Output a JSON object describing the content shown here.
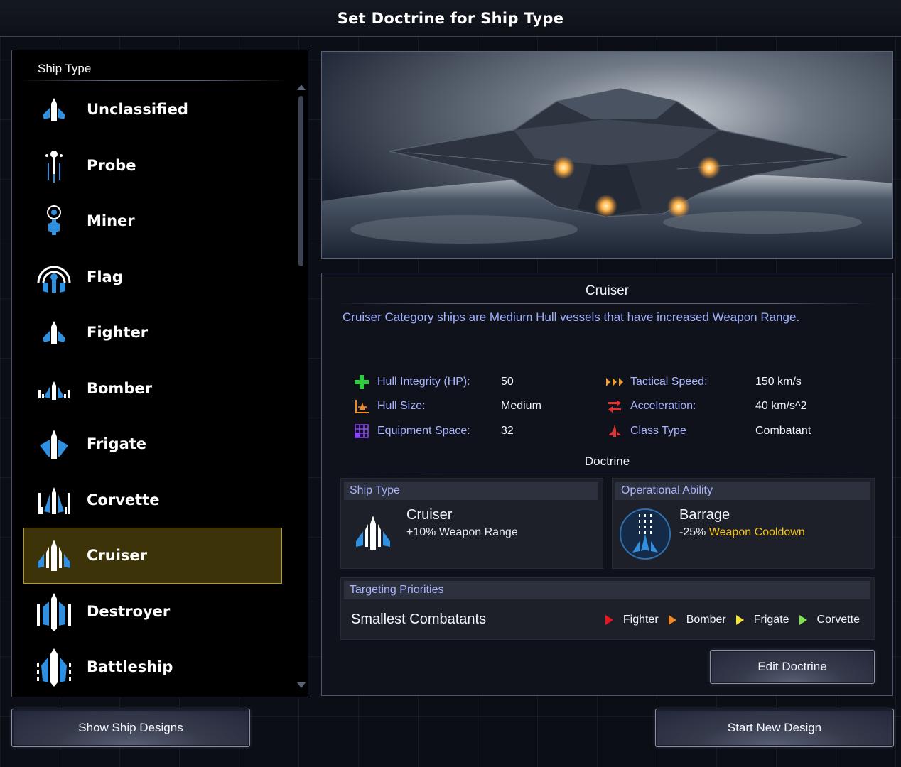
{
  "title": "Set Doctrine for Ship Type",
  "ship_list": {
    "header": "Ship Type",
    "items": [
      {
        "label": "Unclassified",
        "icon": "unclassified-ship-icon"
      },
      {
        "label": "Probe",
        "icon": "probe-ship-icon"
      },
      {
        "label": "Miner",
        "icon": "miner-ship-icon"
      },
      {
        "label": "Flag",
        "icon": "flag-ship-icon"
      },
      {
        "label": "Fighter",
        "icon": "fighter-ship-icon"
      },
      {
        "label": "Bomber",
        "icon": "bomber-ship-icon"
      },
      {
        "label": "Frigate",
        "icon": "frigate-ship-icon"
      },
      {
        "label": "Corvette",
        "icon": "corvette-ship-icon"
      },
      {
        "label": "Cruiser",
        "icon": "cruiser-ship-icon",
        "selected": true
      },
      {
        "label": "Destroyer",
        "icon": "destroyer-ship-icon"
      },
      {
        "label": "Battleship",
        "icon": "battleship-ship-icon"
      }
    ]
  },
  "details": {
    "name": "Cruiser",
    "description": "Cruiser Category ships are Medium Hull vessels that have increased Weapon Range.",
    "stats_left": [
      {
        "label": "Hull Integrity (HP):",
        "value": "50",
        "icon": "plus-icon",
        "color": "#2ecc40"
      },
      {
        "label": "Hull Size:",
        "value": "Medium",
        "icon": "hull-size-icon",
        "color": "#f08a24"
      },
      {
        "label": "Equipment Space:",
        "value": "32",
        "icon": "grid-icon",
        "color": "#8e44ff"
      }
    ],
    "stats_right": [
      {
        "label": "Tactical Speed:",
        "value": "150 km/s",
        "icon": "speed-chevrons-icon",
        "color": "#f0a030"
      },
      {
        "label": "Acceleration:",
        "value": "40 km/s^2",
        "icon": "acceleration-icon",
        "color": "#e83030"
      },
      {
        "label": "Class Type",
        "value": "Combatant",
        "icon": "class-type-icon",
        "color": "#e83030"
      }
    ],
    "doctrine_title": "Doctrine",
    "ship_type_card": {
      "header": "Ship Type",
      "name": "Cruiser",
      "bonus": "+10% Weapon Range"
    },
    "ability_card": {
      "header": "Operational Ability",
      "name": "Barrage",
      "bonus_prefix": "-25%",
      "bonus_highlight": "Weapon Cooldown"
    },
    "targeting": {
      "header": "Targeting Priorities",
      "name": "Smallest Combatants",
      "priorities": [
        {
          "label": "Fighter",
          "color": "#e8141e"
        },
        {
          "label": "Bomber",
          "color": "#f08a24"
        },
        {
          "label": "Frigate",
          "color": "#f2e23a"
        },
        {
          "label": "Corvette",
          "color": "#7ee04a"
        }
      ]
    },
    "edit_button": "Edit Doctrine"
  },
  "buttons": {
    "show_designs": "Show Ship Designs",
    "start_new": "Start New Design"
  },
  "colors": {
    "accent_blue": "#2f8fe0",
    "selected_bg": "#3d3308",
    "highlight_yellow": "#f5c518"
  }
}
